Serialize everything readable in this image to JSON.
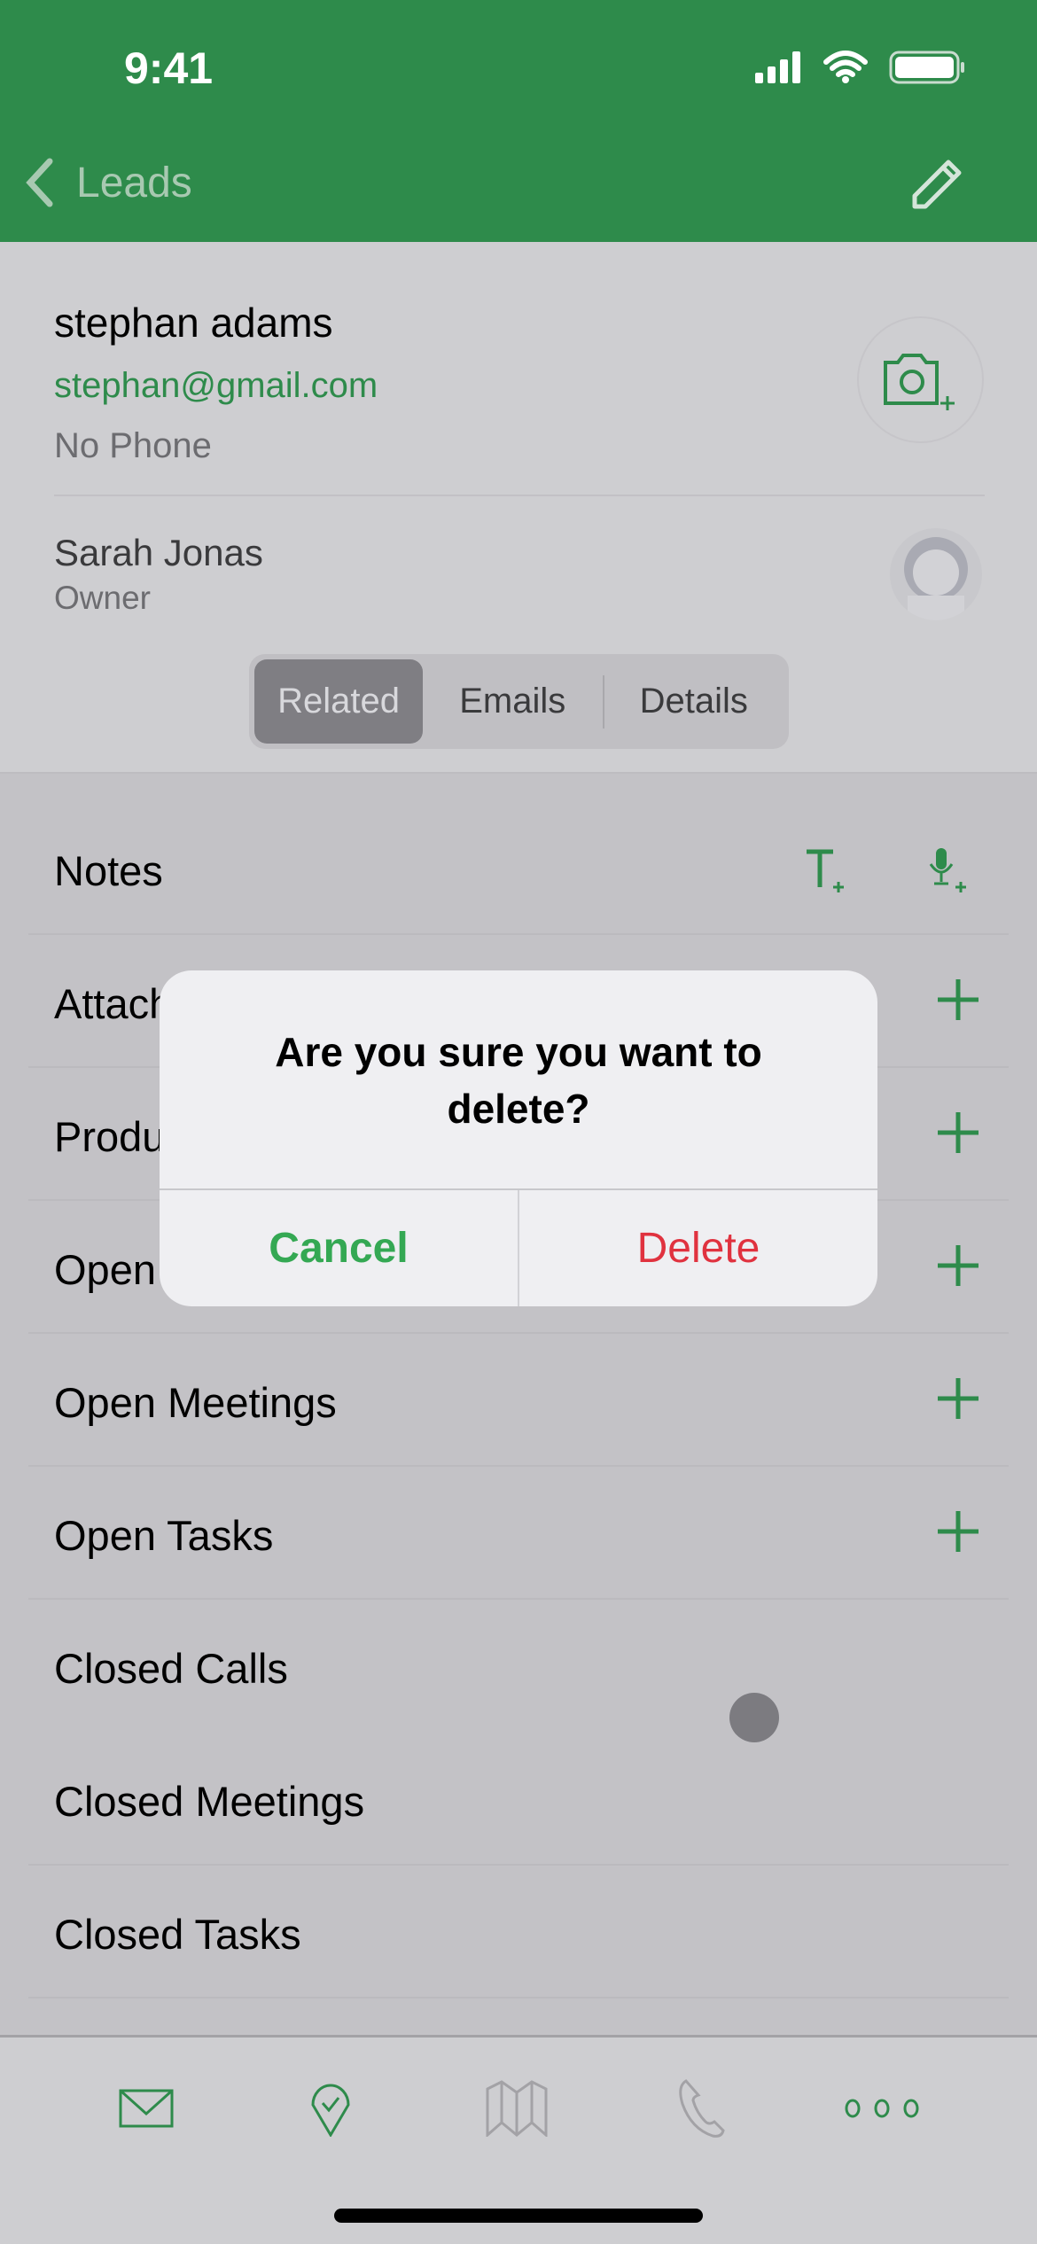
{
  "status_bar": {
    "time": "9:41"
  },
  "nav": {
    "back_label": "Leads"
  },
  "contact": {
    "name": "stephan adams",
    "email": "stephan@gmail.com",
    "phone": "No Phone",
    "owner_name": "Sarah Jonas",
    "owner_role": "Owner"
  },
  "segments": [
    {
      "label": "Related",
      "selected": true
    },
    {
      "label": "Emails"
    },
    {
      "label": "Details"
    }
  ],
  "related": [
    {
      "label": "Notes",
      "actions": [
        "text-note-icon",
        "voice-note-icon"
      ]
    },
    {
      "label": "Attachments",
      "actions": [
        "plus-icon"
      ]
    },
    {
      "label": "Products",
      "actions": [
        "plus-icon"
      ]
    },
    {
      "label": "Open Calls",
      "actions": [
        "plus-icon"
      ]
    },
    {
      "label": "Open Meetings",
      "actions": [
        "plus-icon"
      ]
    },
    {
      "label": "Open Tasks",
      "actions": [
        "plus-icon"
      ]
    },
    {
      "label": "Closed Calls"
    },
    {
      "label": "Closed Meetings"
    },
    {
      "label": "Closed Tasks"
    }
  ],
  "dialog": {
    "title": "Are you sure you want to delete?",
    "cancel": "Cancel",
    "delete": "Delete"
  },
  "tabbar": [
    "mail-icon",
    "checkin-icon",
    "map-icon",
    "phone-icon",
    "more-icon"
  ],
  "colors": {
    "brand": "#2e8b4b",
    "destructive": "#e0323f",
    "cancel": "#34a853"
  }
}
